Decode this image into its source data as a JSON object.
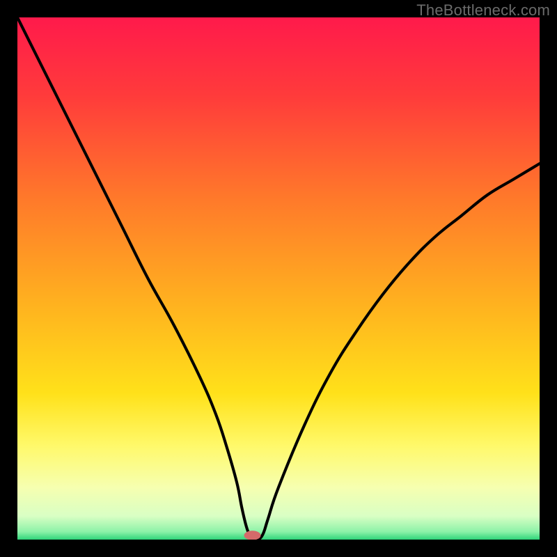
{
  "watermark": "TheBottleneck.com",
  "chart_data": {
    "type": "line",
    "title": "",
    "xlabel": "",
    "ylabel": "",
    "xlim": [
      0,
      100
    ],
    "ylim": [
      0,
      100
    ],
    "grid": false,
    "legend": false,
    "background_gradient_stops": [
      {
        "offset": 0.0,
        "color": "#ff1a4b"
      },
      {
        "offset": 0.15,
        "color": "#ff3b3b"
      },
      {
        "offset": 0.35,
        "color": "#ff7a2a"
      },
      {
        "offset": 0.55,
        "color": "#ffb21f"
      },
      {
        "offset": 0.72,
        "color": "#ffe11a"
      },
      {
        "offset": 0.82,
        "color": "#fff96a"
      },
      {
        "offset": 0.9,
        "color": "#f6ffb0"
      },
      {
        "offset": 0.955,
        "color": "#d9ffc4"
      },
      {
        "offset": 0.985,
        "color": "#8cf2a8"
      },
      {
        "offset": 1.0,
        "color": "#2fd47a"
      }
    ],
    "series": [
      {
        "name": "bottleneck-curve",
        "x": [
          0,
          5,
          10,
          15,
          20,
          25,
          30,
          35,
          38,
          40,
          42,
          43,
          44,
          45,
          46,
          47,
          48,
          50,
          55,
          60,
          65,
          70,
          75,
          80,
          85,
          90,
          95,
          100
        ],
        "y": [
          100,
          90,
          80,
          70,
          60,
          50,
          41,
          31,
          24,
          18,
          11,
          6,
          2,
          0,
          0,
          1,
          4,
          10,
          22,
          32,
          40,
          47,
          53,
          58,
          62,
          66,
          69,
          72
        ]
      }
    ],
    "marker": {
      "x": 45,
      "y": 0.8,
      "rx": 1.6,
      "ry": 0.9,
      "color": "#d46a6a"
    }
  }
}
